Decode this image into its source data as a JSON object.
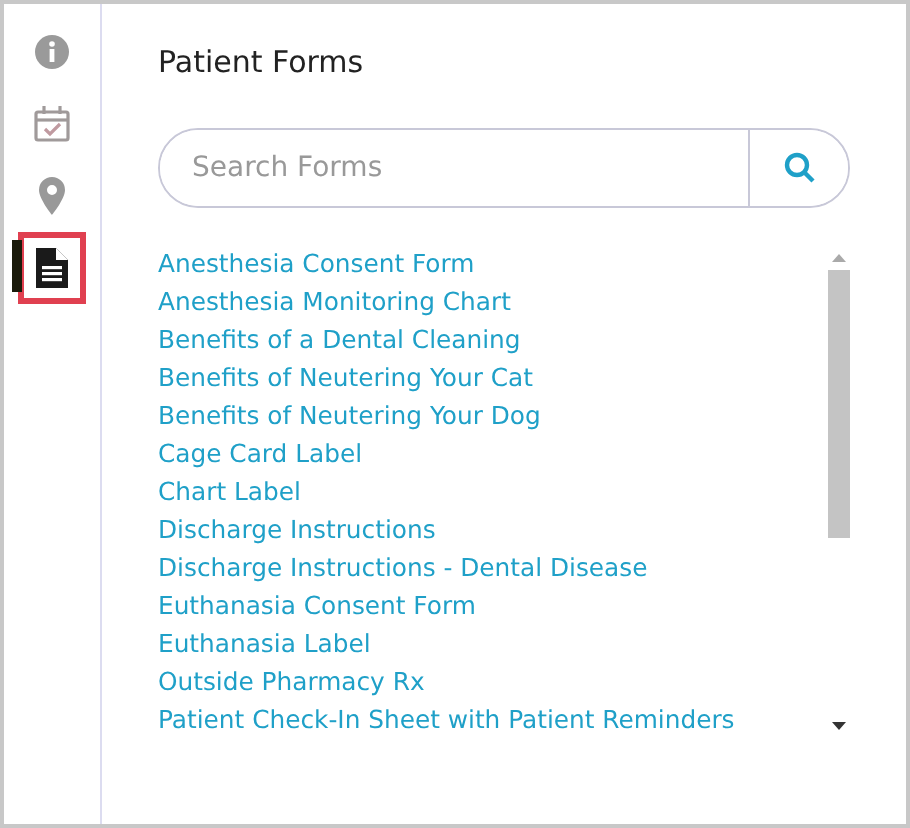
{
  "sidebar": {
    "items": [
      {
        "kind": "info",
        "selected": false
      },
      {
        "kind": "calendar",
        "selected": false
      },
      {
        "kind": "pin",
        "selected": false
      },
      {
        "kind": "document",
        "selected": true
      }
    ]
  },
  "title": "Patient Forms",
  "search": {
    "placeholder": "Search Forms"
  },
  "forms": [
    "Anesthesia Consent Form",
    "Anesthesia Monitoring Chart",
    "Benefits of a Dental Cleaning",
    "Benefits of Neutering Your Cat",
    "Benefits of Neutering Your Dog",
    "Cage Card Label",
    "Chart Label",
    "Discharge Instructions",
    "Discharge Instructions - Dental Disease",
    "Euthanasia Consent Form",
    "Euthanasia Label",
    "Outside Pharmacy Rx",
    "Patient Check-In Sheet with Patient Reminders"
  ]
}
